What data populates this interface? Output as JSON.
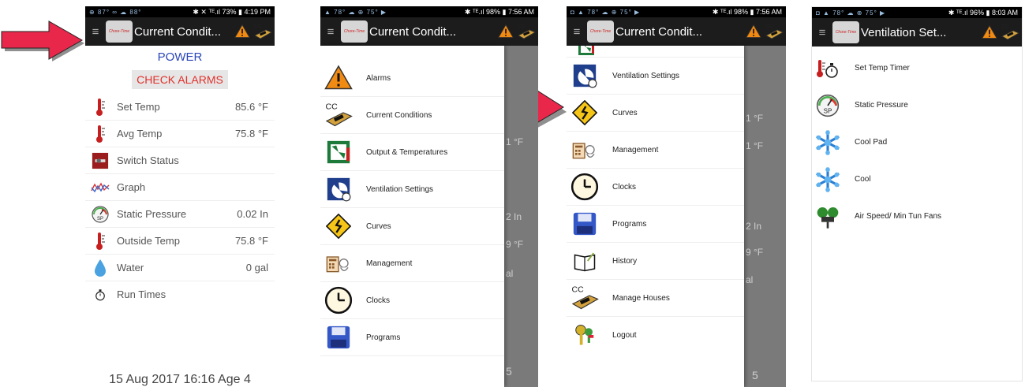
{
  "screen1": {
    "status_left": "⊕ 87° ∞ ☁ 88°",
    "status_right": "✱ ✕ ᵀᴱ.ıl 73% ▮ 4:19 PM",
    "title": "Current Condit...",
    "logo_text": "Chore-Time",
    "power_label": "POWER",
    "check_alarms_label": "CHECK ALARMS",
    "rows": [
      {
        "label": "Set Temp",
        "value": "85.6 °F",
        "icon": "thermometer-icon"
      },
      {
        "label": "Avg Temp",
        "value": "75.8 °F",
        "icon": "thermometer-icon"
      },
      {
        "label": "Switch Status",
        "value": "",
        "icon": "switch-icon"
      },
      {
        "label": "Graph",
        "value": "",
        "icon": "graph-icon"
      },
      {
        "label": "Static Pressure",
        "value": "0.02 In",
        "icon": "gauge-icon"
      },
      {
        "label": "Outside Temp",
        "value": "75.8 °F",
        "icon": "thermometer-icon"
      },
      {
        "label": "Water",
        "value": "0 gal",
        "icon": "water-drop-icon"
      },
      {
        "label": "Run Times",
        "value": "",
        "icon": "timer-icon"
      }
    ],
    "footer": "15 Aug 2017 16:16  Age 4"
  },
  "screen2": {
    "status_left": "▲ 78° ☁ ⊕ 75° ▶",
    "status_right": "✱ ᵀᴱ.ıl 98% ▮ 7:56 AM",
    "title": "Current Condit...",
    "logo_text": "Chore-Time",
    "items": [
      {
        "label": "Alarms",
        "icon": "warning-icon"
      },
      {
        "label": "Current Conditions",
        "icon": "controller-icon"
      },
      {
        "label": "Output & Temperatures",
        "icon": "output-icon"
      },
      {
        "label": "Ventilation Settings",
        "icon": "ventilation-icon"
      },
      {
        "label": "Curves",
        "icon": "curve-sign-icon"
      },
      {
        "label": "Management",
        "icon": "management-icon"
      },
      {
        "label": "Clocks",
        "icon": "clock-icon"
      },
      {
        "label": "Programs",
        "icon": "floppy-disk-icon"
      }
    ],
    "ghost": [
      "1 °F",
      "2 In",
      "9 °F",
      "al",
      "5"
    ]
  },
  "screen3": {
    "status_left": "◘ ▲ 78° ☁ ⊕ 75° ▶",
    "status_right": "✱ ᵀᴱ.ıl 98% ▮ 7:56 AM",
    "title": "Current Condit...",
    "logo_text": "Chore-Time",
    "items": [
      {
        "label": "Ventilation Settings",
        "icon": "ventilation-icon"
      },
      {
        "label": "Curves",
        "icon": "curve-sign-icon"
      },
      {
        "label": "Management",
        "icon": "management-icon"
      },
      {
        "label": "Clocks",
        "icon": "clock-icon"
      },
      {
        "label": "Programs",
        "icon": "floppy-disk-icon"
      },
      {
        "label": "History",
        "icon": "history-book-icon"
      },
      {
        "label": "Manage Houses",
        "icon": "controller-icon"
      },
      {
        "label": "Logout",
        "icon": "keys-icon"
      }
    ],
    "ghost": [
      "1 °F",
      "1 °F",
      "2 In",
      "9 °F",
      "al",
      "5"
    ]
  },
  "screen4": {
    "status_left": "◘ ▲ 78° ☁ ⊕ 75° ▶",
    "status_right": "✱ ᵀᴱ.ıl 96% ▮ 8:03 AM",
    "title": "Ventilation Set...",
    "logo_text": "Chore-Time",
    "items": [
      {
        "label": "Set Temp Timer",
        "icon": "temp-timer-icon"
      },
      {
        "label": "Static Pressure",
        "icon": "gauge-icon"
      },
      {
        "label": "Cool Pad",
        "icon": "snowflake-icon"
      },
      {
        "label": "Cool",
        "icon": "snowflake-icon"
      },
      {
        "label": "Air Speed/ Min Tun Fans",
        "icon": "air-speed-icon"
      }
    ]
  },
  "colors": {
    "arrow": "#e8274b",
    "appbar": "#1c1c1c",
    "power": "#2b46b8",
    "alarm_text": "#e0302a"
  }
}
